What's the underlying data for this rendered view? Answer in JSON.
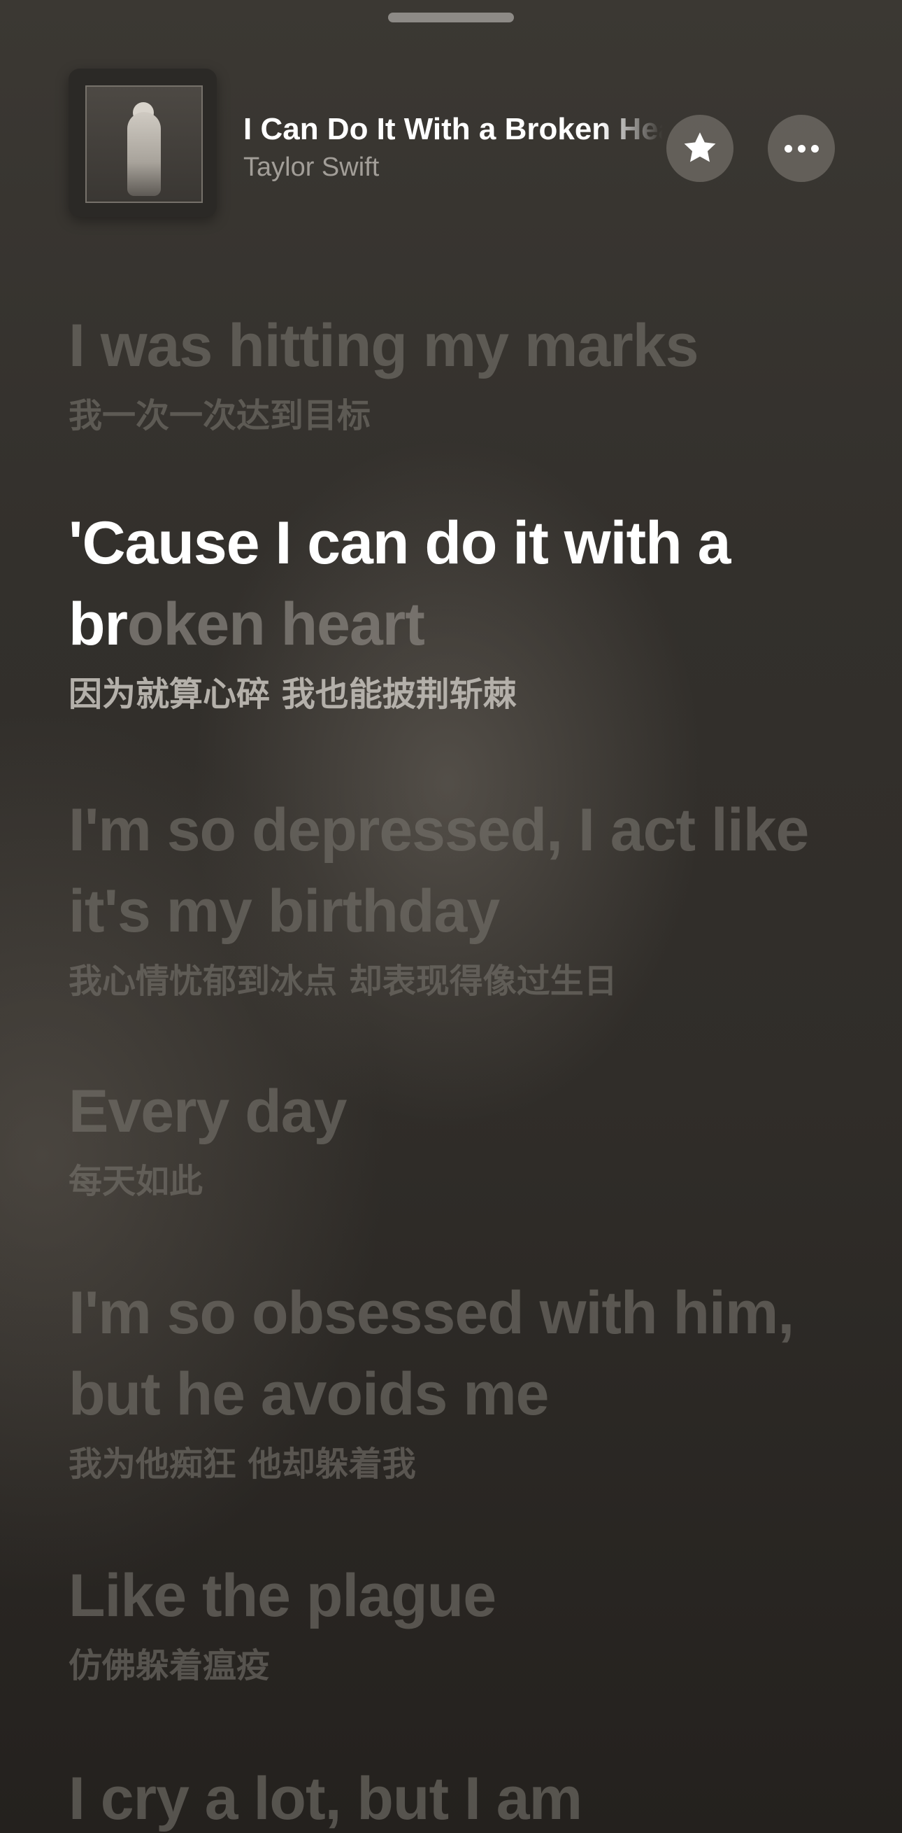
{
  "colors": {
    "background": "#2e2b27",
    "active_lyric": "#ffffff",
    "inactive_lyric": "#76726c"
  },
  "now_playing": {
    "title": "I Can Do It With a Broken Heart",
    "artist": "Taylor Swift",
    "favorite_icon": "star-icon",
    "more_icon": "ellipsis-icon"
  },
  "lyrics": [
    {
      "en": "I was hitting my marks",
      "zh": "我一次一次达到目标"
    },
    {
      "en_sung": "'Cause I can do it with a br",
      "en_rest": "oken heart",
      "zh": "因为就算心碎 我也能披荆斩棘",
      "active": true
    },
    {
      "en": "I'm so depressed, I act like it's my birthday",
      "zh": "我心情忧郁到冰点 却表现得像过生日"
    },
    {
      "en": "Every day",
      "zh": "每天如此"
    },
    {
      "en": "I'm so obsessed with him, but he avoids me",
      "zh": "我为他痴狂 他却躲着我"
    },
    {
      "en": "Like the plague",
      "zh": "仿佛躲着瘟疫"
    },
    {
      "en": "I cry a lot, but I am",
      "zh": ""
    }
  ]
}
